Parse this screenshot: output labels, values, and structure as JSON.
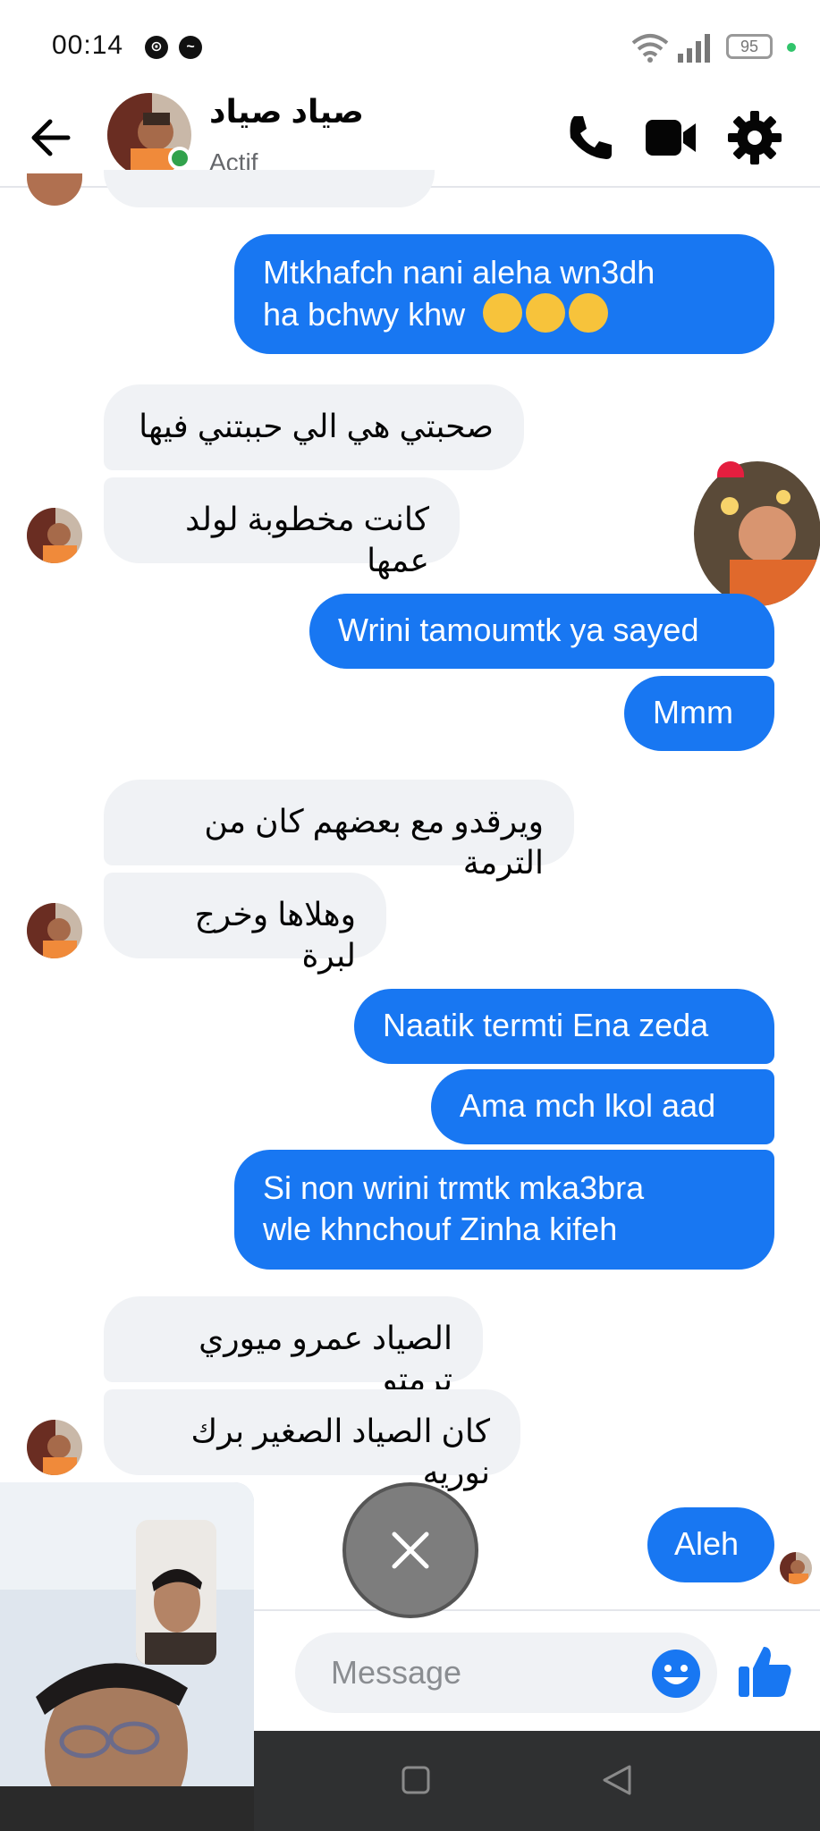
{
  "status_bar": {
    "time": "00:14",
    "battery": "95"
  },
  "header": {
    "contact_name": "صياد صياد",
    "status": "Actif"
  },
  "messages": [
    {
      "side": "out",
      "lines": [
        "Mtkhafch nani aleha wn3dh",
        "ha bchwy khw"
      ],
      "emojis": [
        "smirk-emoji",
        "smirk-emoji",
        "pleading-emoji"
      ]
    },
    {
      "side": "in",
      "text": "صحبتي هي الي حببتني فيها"
    },
    {
      "side": "in",
      "text": "كانت مخطوبة لولد عمها"
    },
    {
      "side": "out",
      "text": "Wrini tamoumtk ya sayed"
    },
    {
      "side": "out",
      "text": "Mmm"
    },
    {
      "side": "in",
      "text": "ويرقدو مع بعضهم كان من الترمة"
    },
    {
      "side": "in",
      "text": "وهلاها وخرج لبرة"
    },
    {
      "side": "out",
      "text": "Naatik termti Ena zeda"
    },
    {
      "side": "out",
      "text": "Ama mch lkol aad"
    },
    {
      "side": "out",
      "lines": [
        "Si non wrini trmtk mka3bra",
        "wle khnchouf Zinha kifeh"
      ]
    },
    {
      "side": "in",
      "text": "الصياد عمرو ميوري ترمتو"
    },
    {
      "side": "in",
      "text": "كان الصياد الصغير برك نوريه"
    },
    {
      "side": "out",
      "text": "Aleh"
    }
  ],
  "composer": {
    "placeholder": "Message"
  },
  "colors": {
    "accent": "#1877f2",
    "incoming_bg": "#f0f2f5",
    "online": "#31a24c"
  }
}
